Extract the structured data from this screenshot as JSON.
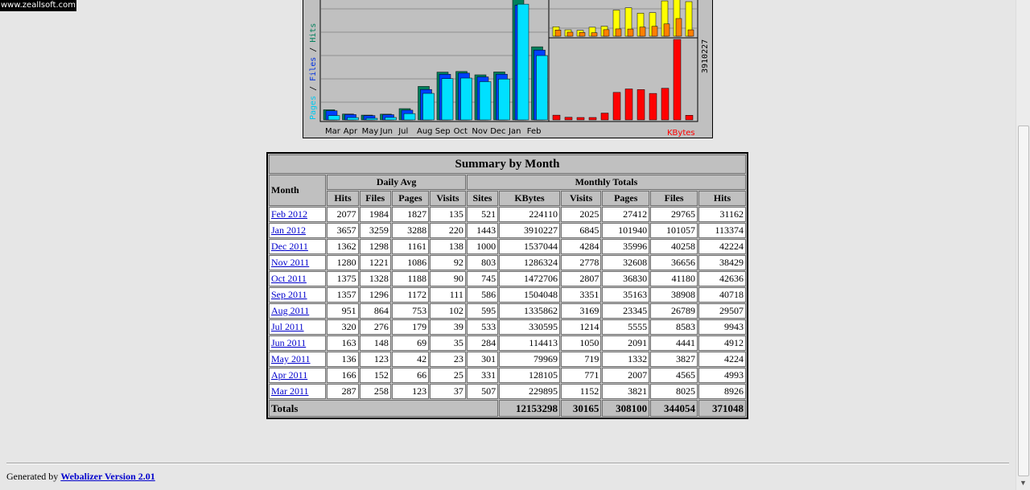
{
  "site_tag": "www.zeallsoft.com",
  "graph": {
    "y_label_pages": "Pages",
    "y_label_sep1": " / ",
    "y_label_files": "Files",
    "y_label_sep2": " / ",
    "y_label_hits": "Hits",
    "months": [
      "Mar",
      "Apr",
      "May",
      "Jun",
      "Jul",
      "Aug",
      "Sep",
      "Oct",
      "Nov",
      "Dec",
      "Jan",
      "Feb"
    ],
    "kbytes_max_label": "3910227",
    "kbytes_label": "KBytes"
  },
  "summary": {
    "title": "Summary by Month",
    "month_header": "Month",
    "daily_avg_header": "Daily Avg",
    "monthly_totals_header": "Monthly Totals",
    "daily_cols": [
      "Hits",
      "Files",
      "Pages",
      "Visits"
    ],
    "monthly_cols": [
      "Sites",
      "KBytes",
      "Visits",
      "Pages",
      "Files",
      "Hits"
    ],
    "rows": [
      {
        "month": "Feb 2012",
        "d_hits": "2077",
        "d_files": "1984",
        "d_pages": "1827",
        "d_visits": "135",
        "sites": "521",
        "kbytes": "224110",
        "visits": "2025",
        "pages": "27412",
        "files": "29765",
        "hits": "31162"
      },
      {
        "month": "Jan 2012",
        "d_hits": "3657",
        "d_files": "3259",
        "d_pages": "3288",
        "d_visits": "220",
        "sites": "1443",
        "kbytes": "3910227",
        "visits": "6845",
        "pages": "101940",
        "files": "101057",
        "hits": "113374"
      },
      {
        "month": "Dec 2011",
        "d_hits": "1362",
        "d_files": "1298",
        "d_pages": "1161",
        "d_visits": "138",
        "sites": "1000",
        "kbytes": "1537044",
        "visits": "4284",
        "pages": "35996",
        "files": "40258",
        "hits": "42224"
      },
      {
        "month": "Nov 2011",
        "d_hits": "1280",
        "d_files": "1221",
        "d_pages": "1086",
        "d_visits": "92",
        "sites": "803",
        "kbytes": "1286324",
        "visits": "2778",
        "pages": "32608",
        "files": "36656",
        "hits": "38429"
      },
      {
        "month": "Oct 2011",
        "d_hits": "1375",
        "d_files": "1328",
        "d_pages": "1188",
        "d_visits": "90",
        "sites": "745",
        "kbytes": "1472706",
        "visits": "2807",
        "pages": "36830",
        "files": "41180",
        "hits": "42636"
      },
      {
        "month": "Sep 2011",
        "d_hits": "1357",
        "d_files": "1296",
        "d_pages": "1172",
        "d_visits": "111",
        "sites": "586",
        "kbytes": "1504048",
        "visits": "3351",
        "pages": "35163",
        "files": "38908",
        "hits": "40718"
      },
      {
        "month": "Aug 2011",
        "d_hits": "951",
        "d_files": "864",
        "d_pages": "753",
        "d_visits": "102",
        "sites": "595",
        "kbytes": "1335862",
        "visits": "3169",
        "pages": "23345",
        "files": "26789",
        "hits": "29507"
      },
      {
        "month": "Jul 2011",
        "d_hits": "320",
        "d_files": "276",
        "d_pages": "179",
        "d_visits": "39",
        "sites": "533",
        "kbytes": "330595",
        "visits": "1214",
        "pages": "5555",
        "files": "8583",
        "hits": "9943"
      },
      {
        "month": "Jun 2011",
        "d_hits": "163",
        "d_files": "148",
        "d_pages": "69",
        "d_visits": "35",
        "sites": "284",
        "kbytes": "114413",
        "visits": "1050",
        "pages": "2091",
        "files": "4441",
        "hits": "4912"
      },
      {
        "month": "May 2011",
        "d_hits": "136",
        "d_files": "123",
        "d_pages": "42",
        "d_visits": "23",
        "sites": "301",
        "kbytes": "79969",
        "visits": "719",
        "pages": "1332",
        "files": "3827",
        "hits": "4224"
      },
      {
        "month": "Apr 2011",
        "d_hits": "166",
        "d_files": "152",
        "d_pages": "66",
        "d_visits": "25",
        "sites": "331",
        "kbytes": "128105",
        "visits": "771",
        "pages": "2007",
        "files": "4565",
        "hits": "4993"
      },
      {
        "month": "Mar 2011",
        "d_hits": "287",
        "d_files": "258",
        "d_pages": "123",
        "d_visits": "37",
        "sites": "507",
        "kbytes": "229895",
        "visits": "1152",
        "pages": "3821",
        "files": "8025",
        "hits": "8926"
      }
    ],
    "totals": {
      "label": "Totals",
      "kbytes": "12153298",
      "visits": "30165",
      "pages": "308100",
      "files": "344054",
      "hits": "371048"
    }
  },
  "footer": {
    "prefix": "Generated by ",
    "link": "Webalizer Version 2.01"
  },
  "colors": {
    "hits": "#00805c",
    "files": "#0040ff",
    "pages": "#00e0ff",
    "visits": "#ffff00",
    "sites": "#ff8000",
    "kbytes": "#ff0000"
  }
}
